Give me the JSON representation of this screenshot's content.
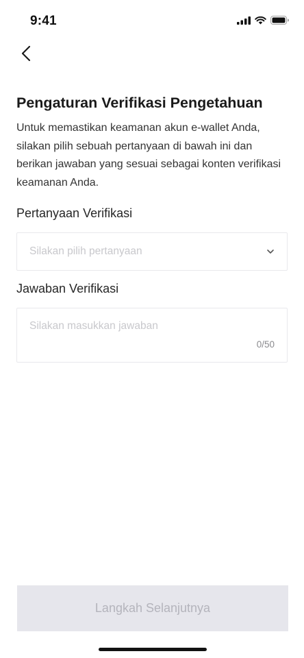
{
  "status_bar": {
    "time": "9:41",
    "icons": [
      "cellular-signal-icon",
      "wifi-icon",
      "battery-icon"
    ]
  },
  "header": {
    "back_icon": "chevron-left-icon"
  },
  "page": {
    "title": "Pengaturan Verifikasi Pengetahuan",
    "description": "Untuk memastikan keamanan akun e-wallet Anda, silakan pilih sebuah pertanyaan di bawah ini dan berikan jawaban yang sesuai sebagai konten verifikasi keamanan Anda."
  },
  "question_field": {
    "label": "Pertanyaan Verifikasi",
    "placeholder": "Silakan pilih pertanyaan",
    "icon": "chevron-down-icon"
  },
  "answer_field": {
    "label": "Jawaban Verifikasi",
    "placeholder": "Silakan masukkan jawaban",
    "value": "",
    "counter": "0/50"
  },
  "footer": {
    "next_label": "Langkah Selanjutnya"
  },
  "colors": {
    "button_disabled_bg": "#e6e6ec",
    "button_disabled_text": "#b4b4bc",
    "placeholder": "#c8c8cc",
    "border": "#e8e8ec"
  }
}
